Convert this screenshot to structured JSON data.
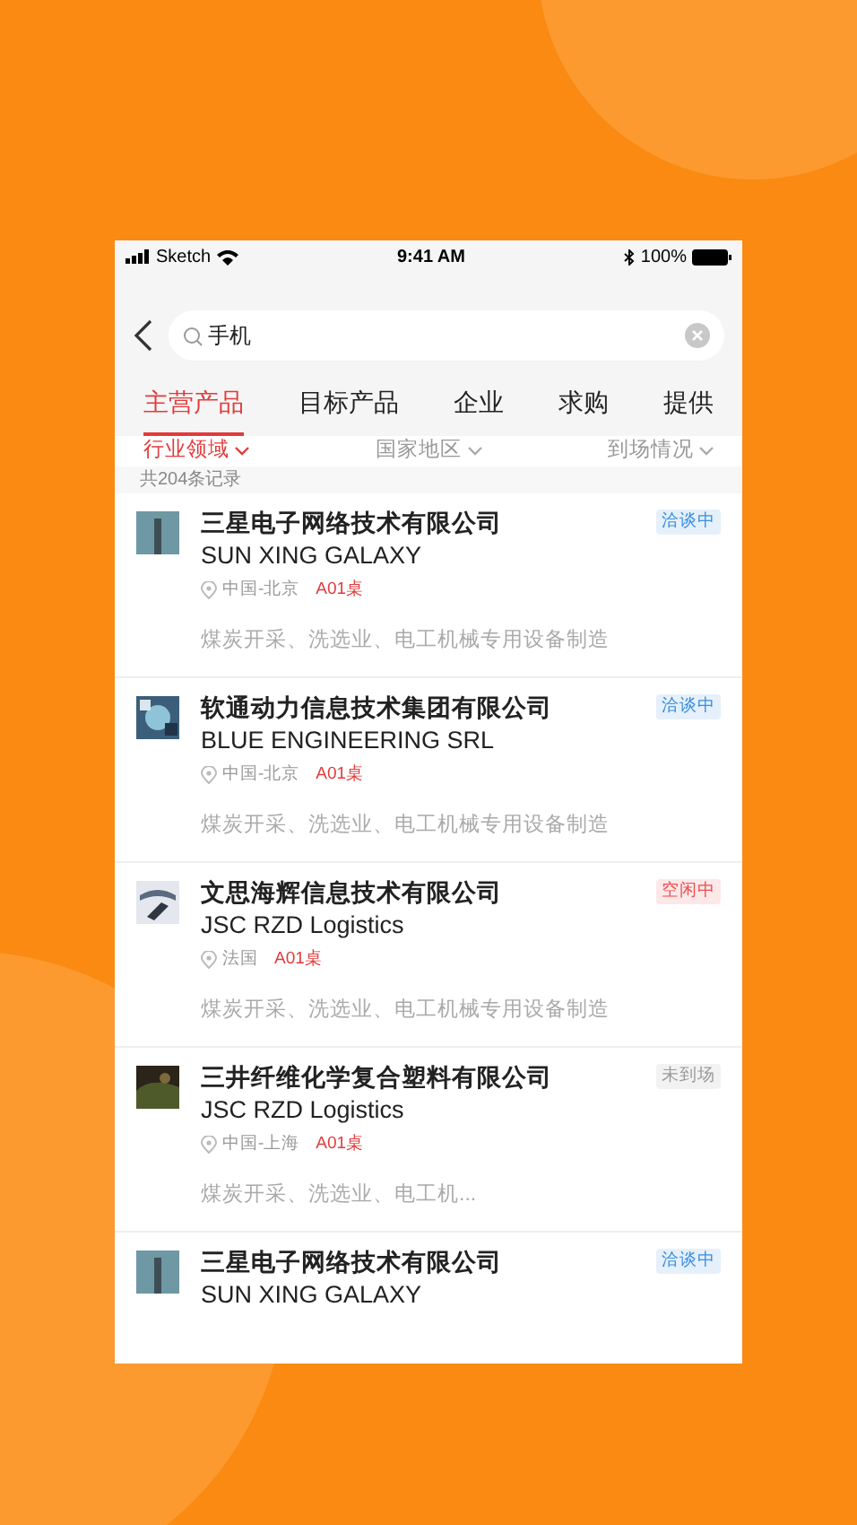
{
  "status_bar": {
    "carrier": "Sketch",
    "time": "9:41 AM",
    "battery": "100%"
  },
  "search": {
    "value": "手机"
  },
  "tabs": [
    {
      "label": "主营产品",
      "selected": true
    },
    {
      "label": "目标产品",
      "selected": false
    },
    {
      "label": "企业",
      "selected": false
    },
    {
      "label": "求购",
      "selected": false
    },
    {
      "label": "提供",
      "selected": false
    }
  ],
  "filters": [
    {
      "label": "行业领域",
      "selected": true
    },
    {
      "label": "国家地区",
      "selected": false
    },
    {
      "label": "到场情况",
      "selected": false
    }
  ],
  "record_count": "共204条记录",
  "companies": [
    {
      "name": "三星电子网络技术有限公司",
      "english_name": "SUN XING GALAXY",
      "location": "中国-北京",
      "table": "A01桌",
      "industry": "煤炭开采、洗选业、电工机械专用设备制造",
      "status": "洽谈中",
      "color": "#3b8fe0"
    },
    {
      "name": "软通动力信息技术集团有限公司",
      "english_name": "BLUE ENGINEERING SRL",
      "location": "中国-北京",
      "table": "A01桌",
      "industry": "煤炭开采、洗选业、电工机械专用设备制造",
      "status": "洽谈中",
      "color": "#3b8fe0"
    },
    {
      "name": "文思海辉信息技术有限公司",
      "english_name": "JSC RZD Logistics",
      "location": "法国",
      "table": "A01桌",
      "industry": "煤炭开采、洗选业、电工机械专用设备制造",
      "status": "空闲中",
      "color": "#e8504f"
    },
    {
      "name": "三井纤维化学复合塑料有限公司",
      "english_name": "JSC RZD Logistics",
      "location": "中国-上海",
      "table": "A01桌",
      "industry": "煤炭开采、洗选业、电工机...",
      "status": "未到场",
      "color": "#9a9a9a"
    },
    {
      "name": "三星电子网络技术有限公司",
      "english_name": "SUN XING GALAXY",
      "status": "洽谈中",
      "color": "#3b8fe0"
    }
  ]
}
